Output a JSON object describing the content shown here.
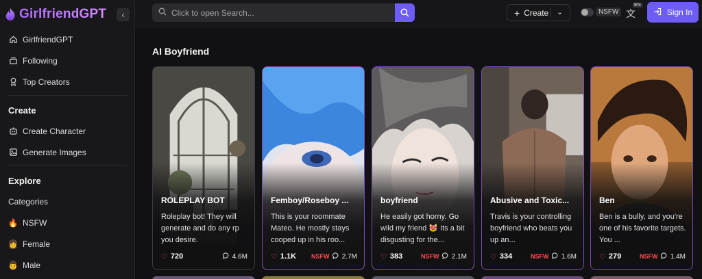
{
  "brand": {
    "name": "GirlfriendGPT",
    "collapse_icon": "chevron-left-icon"
  },
  "sidebar": {
    "nav": [
      {
        "label": "GirlfriendGPT",
        "icon": "home-icon"
      },
      {
        "label": "Following",
        "icon": "stack-icon"
      },
      {
        "label": "Top Creators",
        "icon": "award-icon"
      }
    ],
    "create_title": "Create",
    "create_items": [
      {
        "label": "Create Character",
        "icon": "robot-icon"
      },
      {
        "label": "Generate Images",
        "icon": "image-icon"
      }
    ],
    "explore_title": "Explore",
    "explore_items": [
      {
        "label": "Categories",
        "icon": ""
      },
      {
        "label": "NSFW",
        "icon": "🔥"
      },
      {
        "label": "Female",
        "icon": "👩"
      },
      {
        "label": "Male",
        "icon": "👨"
      }
    ]
  },
  "header": {
    "search_placeholder": "Click to open Search...",
    "create_label": "Create",
    "nsfw_label": "NSFW",
    "lang_badge": "EN",
    "signin_label": "Sign In"
  },
  "main": {
    "section_title": "AI Boyfriend",
    "cards": [
      {
        "title": "ROLEPLAY BOT",
        "desc": "Roleplay bot! They will generate and do any rp you desire.",
        "likes": "720",
        "nsfw": "",
        "chats": "4.6M"
      },
      {
        "title": "Femboy/Roseboy ...",
        "desc": "This is your roommate Mateo. He mostly stays cooped up in his roo...",
        "likes": "1.1K",
        "nsfw": "NSFW",
        "chats": "2.7M"
      },
      {
        "title": "boyfriend",
        "desc": "He easily got horny. Go wild my friend 😻 Its a bit disgusting for the...",
        "likes": "383",
        "nsfw": "NSFW",
        "chats": "2.1M"
      },
      {
        "title": "Abusive and Toxic...",
        "desc": "Travis is your controlling boyfriend who beats you up an...",
        "likes": "334",
        "nsfw": "NSFW",
        "chats": "1.6M"
      },
      {
        "title": "Ben",
        "desc": "Ben is a bully, and you're one of his favorite targets. You ...",
        "likes": "279",
        "nsfw": "NSFW",
        "chats": "1.4M"
      }
    ]
  },
  "colors": {
    "accent": "#6d5cf5",
    "brand": "#b06cff",
    "nsfw": "#ff4d55",
    "heart": "#f05a6e"
  }
}
